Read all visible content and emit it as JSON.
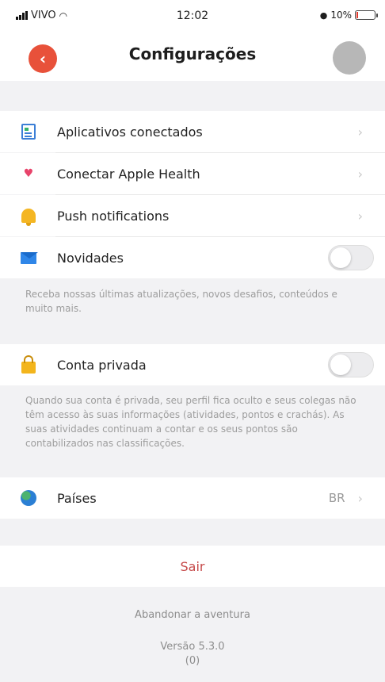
{
  "status_bar": {
    "carrier": "VIVO",
    "time": "12:02",
    "battery": "10%",
    "battery_level": 0.1
  },
  "header": {
    "title": "Configurações",
    "back_icon": "chevron-left-icon"
  },
  "settings": {
    "connected_apps": {
      "label": "Aplicativos conectados",
      "icon": "apps-icon"
    },
    "apple_health": {
      "label": "Conectar Apple Health",
      "icon": "heart-icon"
    },
    "push": {
      "label": "Push notifications",
      "icon": "bell-icon"
    },
    "news": {
      "label": "Novidades",
      "icon": "mail-icon",
      "enabled": false,
      "note": "Receba nossas últimas atualizações, novos desafios, conteúdos e muito mais."
    },
    "private_account": {
      "label": "Conta privada",
      "icon": "lock-icon",
      "enabled": false,
      "note": "Quando sua conta é privada, seu perfil fica oculto e seus colegas não têm acesso às suas informações (atividades, pontos e crachás). As suas atividades continuam a contar e os seus pontos são contabilizados nas classificações."
    },
    "countries": {
      "label": "Países",
      "icon": "globe-icon",
      "value": "BR"
    }
  },
  "actions": {
    "logout": "Sair",
    "abandon": "Abandonar a aventura"
  },
  "footer": {
    "version": "Versão 5.3.0",
    "build": "(0)"
  },
  "colors": {
    "accent": "#e8513a",
    "logout_text": "#c64a4a",
    "background": "#f2f2f4"
  }
}
